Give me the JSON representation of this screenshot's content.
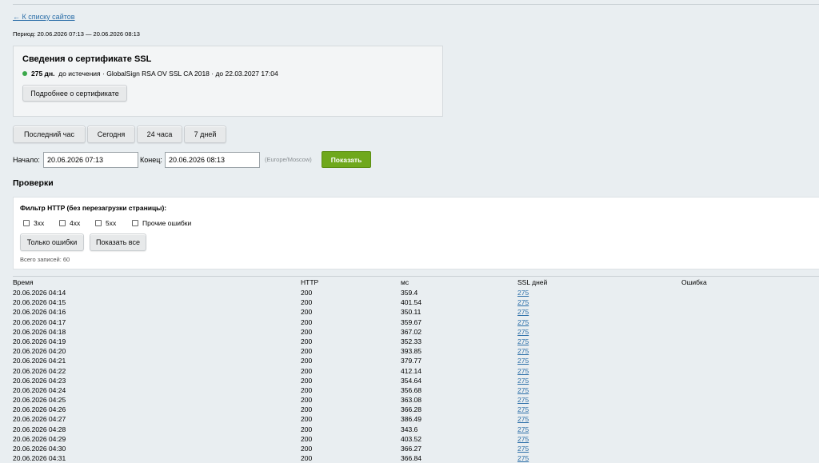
{
  "nav": {
    "back_link": "← К списку сайтов"
  },
  "period_text": "Период: 20.06.2026 07:13 — 20.06.2026 08:13",
  "ssl": {
    "title": "Сведения о сертификате SSL",
    "days": "275 дн.",
    "info": "до истечения · GlobalSign RSA OV SSL CA 2018 · до 22.03.2027 17:04",
    "status_color": "#3aa84a",
    "details_button": "Подробнее о сертификате"
  },
  "ranges": [
    "Последний час",
    "Сегодня",
    "24 часа",
    "7 дней"
  ],
  "form": {
    "start_label": "Начало:",
    "start_value": "20.06.2026 07:13",
    "end_label": "Конец:",
    "end_value": "20.06.2026 08:13",
    "timezone": "(Europe/Moscow)",
    "submit": "Показать",
    "submit_color": "#6fa81c"
  },
  "checks": {
    "title": "Проверки",
    "filter_title": "Фильтр HTTP (без перезагрузки страницы):",
    "checkboxes": [
      "3xx",
      "4xx",
      "5xx",
      "Прочие ошибки"
    ],
    "only_errors": "Только ошибки",
    "show_all": "Показать все",
    "total": "Всего записей: 60"
  },
  "table": {
    "columns": [
      "Время",
      "HTTP",
      "мс",
      "SSL дней",
      "Ошибка"
    ],
    "rows": [
      [
        "20.06.2026 04:14",
        "200",
        "359.4",
        "275",
        ""
      ],
      [
        "20.06.2026 04:15",
        "200",
        "401.54",
        "275",
        ""
      ],
      [
        "20.06.2026 04:16",
        "200",
        "350.11",
        "275",
        ""
      ],
      [
        "20.06.2026 04:17",
        "200",
        "359.67",
        "275",
        ""
      ],
      [
        "20.06.2026 04:18",
        "200",
        "367.02",
        "275",
        ""
      ],
      [
        "20.06.2026 04:19",
        "200",
        "352.33",
        "275",
        ""
      ],
      [
        "20.06.2026 04:20",
        "200",
        "393.85",
        "275",
        ""
      ],
      [
        "20.06.2026 04:21",
        "200",
        "379.77",
        "275",
        ""
      ],
      [
        "20.06.2026 04:22",
        "200",
        "412.14",
        "275",
        ""
      ],
      [
        "20.06.2026 04:23",
        "200",
        "354.64",
        "275",
        ""
      ],
      [
        "20.06.2026 04:24",
        "200",
        "356.68",
        "275",
        ""
      ],
      [
        "20.06.2026 04:25",
        "200",
        "363.08",
        "275",
        ""
      ],
      [
        "20.06.2026 04:26",
        "200",
        "366.28",
        "275",
        ""
      ],
      [
        "20.06.2026 04:27",
        "200",
        "386.49",
        "275",
        ""
      ],
      [
        "20.06.2026 04:28",
        "200",
        "343.6",
        "275",
        ""
      ],
      [
        "20.06.2026 04:29",
        "200",
        "403.52",
        "275",
        ""
      ],
      [
        "20.06.2026 04:30",
        "200",
        "366.27",
        "275",
        ""
      ],
      [
        "20.06.2026 04:31",
        "200",
        "366.84",
        "275",
        ""
      ]
    ]
  }
}
